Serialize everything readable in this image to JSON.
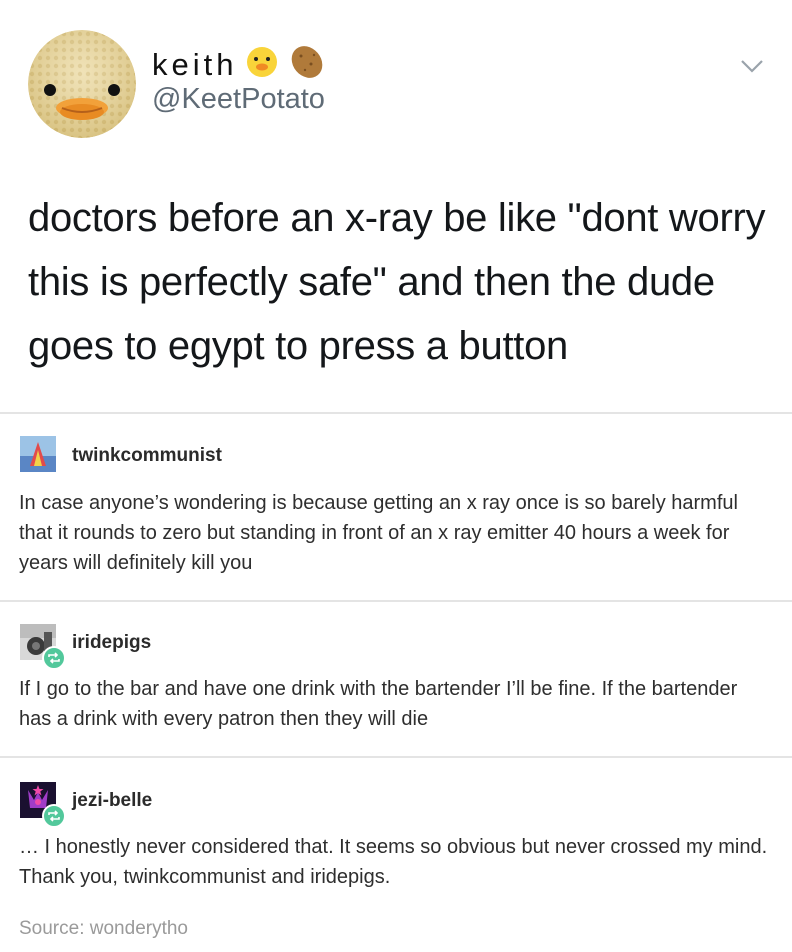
{
  "tweet": {
    "display_name": "keith",
    "handle": "@KeetPotato",
    "text": "doctors before an x-ray be like \"dont worry this is perfectly safe\" and then the dude goes to egypt to press a button",
    "emojis": [
      "chick-face-icon",
      "potato-icon"
    ]
  },
  "reblogs": [
    {
      "username": "twinkcommunist",
      "body": "In case anyone’s wondering is because getting an x ray once is so barely harmful that it rounds to zero but standing in front of an x ray emitter 40 hours a week for years will definitely kill you",
      "reblog_badge": false
    },
    {
      "username": "iridepigs",
      "body": "If I go to the bar and have one drink with the bartender I’ll be fine. If the bartender has a drink with every patron then they will die",
      "reblog_badge": true
    },
    {
      "username": "jezi-belle",
      "body": "… I honestly never considered that. It seems so obvious but never crossed my mind. Thank you, twinkcommunist and iridepigs.",
      "reblog_badge": true
    }
  ],
  "source": {
    "label": "Source:",
    "name": "wonderytho"
  },
  "colors": {
    "handle_gray": "#5f6b76",
    "divider": "#e4e4e4",
    "reblog_badge_green": "#52c89b",
    "source_gray": "#9a9a9a"
  }
}
